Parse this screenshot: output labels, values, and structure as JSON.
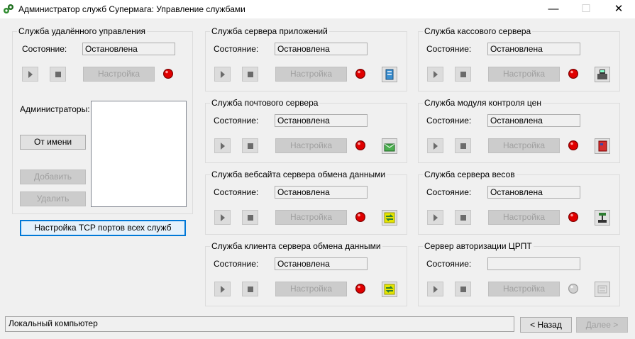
{
  "window": {
    "title": "Администратор служб Супермага: Управление службами",
    "minimize": "—",
    "maximize": "☐",
    "close": "✕"
  },
  "remote": {
    "title": "Служба удалённого управления",
    "state_label": "Состояние:",
    "state_value": "Остановлена",
    "settings": "Настройка",
    "admins_label": "Администраторы:",
    "as_user": "От имени",
    "add": "Добавить",
    "remove": "Удалить",
    "status_color": "#e00000"
  },
  "tcp_button": "Настройка TCP портов всех служб",
  "services": [
    {
      "title": "Служба сервера приложений",
      "state_label": "Состояние:",
      "state_value": "Остановлена",
      "settings": "Настройка",
      "icon": "server-icon",
      "status_color": "#e00000"
    },
    {
      "title": "Служба кассового сервера",
      "state_label": "Состояние:",
      "state_value": "Остановлена",
      "settings": "Настройка",
      "icon": "cash-register-icon",
      "status_color": "#e00000"
    },
    {
      "title": "Служба почтового сервера",
      "state_label": "Состояние:",
      "state_value": "Остановлена",
      "settings": "Настройка",
      "icon": "mail-icon",
      "status_color": "#e00000"
    },
    {
      "title": "Служба модуля контроля цен",
      "state_label": "Состояние:",
      "state_value": "Остановлена",
      "settings": "Настройка",
      "icon": "price-tag-icon",
      "status_color": "#e00000"
    },
    {
      "title": "Служба вебсайта сервера обмена данными",
      "state_label": "Состояние:",
      "state_value": "Остановлена",
      "settings": "Настройка",
      "icon": "exchange-icon",
      "status_color": "#e00000"
    },
    {
      "title": "Служба сервера весов",
      "state_label": "Состояние:",
      "state_value": "Остановлена",
      "settings": "Настройка",
      "icon": "scales-icon",
      "status_color": "#e00000"
    },
    {
      "title": "Служба клиента сервера обмена данными",
      "state_label": "Состояние:",
      "state_value": "Остановлена",
      "settings": "Настройка",
      "icon": "exchange-icon",
      "status_color": "#e00000"
    },
    {
      "title": "Сервер авторизации ЦРПТ",
      "state_label": "Состояние:",
      "state_value": "",
      "settings": "Настройка",
      "icon": "auth-server-icon",
      "status_color": "#d0d0d0"
    }
  ],
  "footer": {
    "status": "Локальный компьютер",
    "back": "< Назад",
    "next": "Далее >"
  }
}
